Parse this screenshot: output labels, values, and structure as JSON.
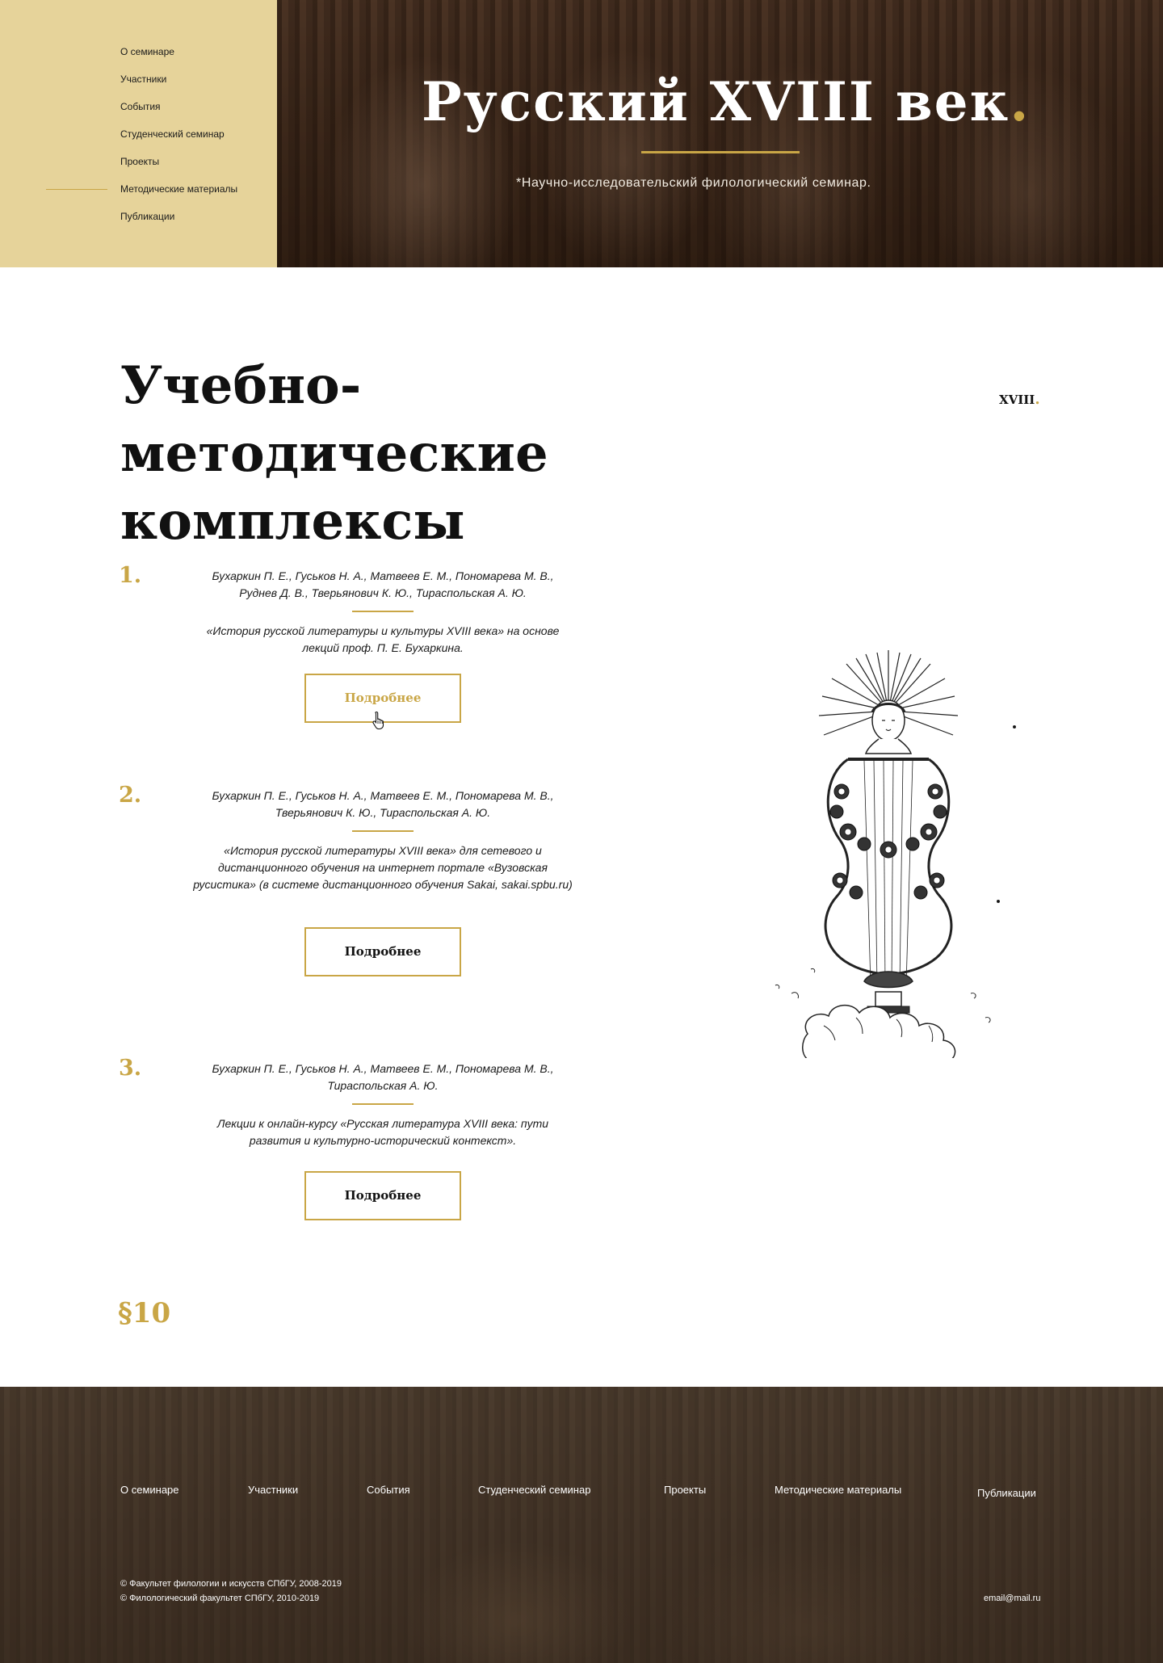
{
  "sidebar": {
    "nav": [
      {
        "label": "О семинаре"
      },
      {
        "label": "Участники"
      },
      {
        "label": "События"
      },
      {
        "label": "Студенческий семинар"
      },
      {
        "label": "Проекты"
      },
      {
        "label": "Методические материалы",
        "active": true
      },
      {
        "label": "Публикации"
      }
    ]
  },
  "hero": {
    "title": "Русский XVIII век",
    "dot": ".",
    "subtitle": "*Научно-исследовательский филологический семинар."
  },
  "main": {
    "title": "Учебно-методические комплексы",
    "mark": "XVIII",
    "mark_dot": ".",
    "items": [
      {
        "num": "1.",
        "authors": "Бухаркин П. Е., Гуськов Н. А., Матвеев Е. М., Пономарева М. В., Руднев Д. В., Тверьянович К. Ю., Тираспольская А. Ю.",
        "description": "«История русской литературы и культуры XVIII века» на основе лекций проф. П. Е. Бухаркина.",
        "button": "Подробнее"
      },
      {
        "num": "2.",
        "authors": "Бухаркин П. Е., Гуськов Н. А., Матвеев Е. М., Пономарева М. В., Тверьянович К. Ю., Тираспольская А. Ю.",
        "description": "«История русской литературы XVIII века» для сетевого и дистанционного обучения на интернет портале «Вузовская русистика» (в системе дистанционного обучения Sakai, sakai.spbu.ru)",
        "button": "Подробнее"
      },
      {
        "num": "3.",
        "authors": "Бухаркин П. Е., Гуськов Н. А., Матвеев Е. М., Пономарева М. В., Тираспольская А. Ю.",
        "description": "Лекции к онлайн-курсу «Русская литература XVIII века: пути развития и культурно-исторический контекст».",
        "button": "Подробнее"
      }
    ],
    "section_number": "§10"
  },
  "footer": {
    "nav": [
      {
        "label": "О семинаре"
      },
      {
        "label": "Участники"
      },
      {
        "label": "События"
      },
      {
        "label": "Студенческий семинар"
      },
      {
        "label": "Проекты"
      },
      {
        "label": "Методические материалы"
      },
      {
        "label": "Публикации"
      }
    ],
    "copyright": [
      "© Факультет филологии и искусств СПбГУ, 2008-2019",
      "© Филологический факультет СПбГУ, 2010-2019"
    ],
    "email": "email@mail.ru"
  },
  "colors": {
    "accent": "#c9a646",
    "sidebar_bg": "#e6d39a",
    "text": "#111111"
  },
  "icons": [
    "hand-pointer-cursor-icon",
    "lyre-illustration-icon"
  ]
}
